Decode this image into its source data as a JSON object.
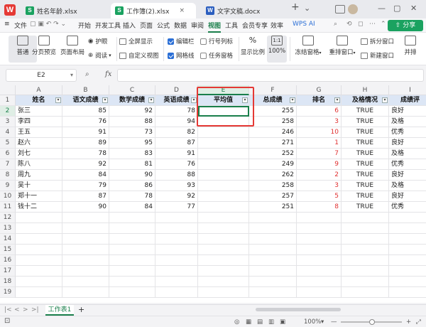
{
  "titlebar": {
    "logo": "W",
    "tabs": [
      {
        "label": "姓名年龄.xlsx",
        "icon": "S",
        "kind": "sheet"
      },
      {
        "label": "工作簿(2).xlsx",
        "icon": "S",
        "kind": "sheet"
      },
      {
        "label": "文字文稿.docx",
        "icon": "W",
        "kind": "doc"
      }
    ],
    "new_tab": "+",
    "dropdown": "⌄"
  },
  "menubar": {
    "file": "文件",
    "items": [
      "开始",
      "开发工具",
      "插入",
      "页面",
      "公式",
      "数据",
      "审阅",
      "视图",
      "工具",
      "会员专享",
      "效率"
    ],
    "active": "视图",
    "wps_ai": "WPS AI",
    "share": "分享"
  },
  "ribbon": {
    "big_buttons": [
      "普通",
      "分页预览",
      "页面布局"
    ],
    "small_left": [
      "护眼",
      "阅读"
    ],
    "fullscreen": "全屏显示",
    "custom_view": "自定义视图",
    "checks": [
      {
        "label": "编辑栏",
        "checked": true
      },
      {
        "label": "网格线",
        "checked": true
      },
      {
        "label": "行号列标",
        "checked": false
      },
      {
        "label": "任务窗格",
        "checked": false
      }
    ],
    "display_ratio": "显示比例",
    "zoom_button": "100%",
    "freeze": "冻结窗格",
    "rearrange": "重排窗口",
    "split": "拆分窗口",
    "new_window": "新建窗口",
    "side_by_side": "并排"
  },
  "formula": {
    "cell_ref": "E2",
    "fx": "fx",
    "value": ""
  },
  "columns": [
    "A",
    "B",
    "C",
    "D",
    "E",
    "F",
    "G",
    "H",
    "I"
  ],
  "rows": [
    "1",
    "2",
    "3",
    "4",
    "5",
    "6",
    "7",
    "8",
    "9",
    "10",
    "11",
    "12",
    "13",
    "14",
    "15",
    "16",
    "17",
    "18",
    "19"
  ],
  "table": {
    "headers": [
      "姓名",
      "语文成绩",
      "数学成绩",
      "英语成绩",
      "平均值",
      "总成绩",
      "排名",
      "及格情况",
      "成绩评"
    ],
    "data": [
      [
        "张三",
        "85",
        "92",
        "78",
        "",
        "255",
        "6",
        "TRUE",
        "良好"
      ],
      [
        "李四",
        "76",
        "88",
        "94",
        "",
        "258",
        "3",
        "TRUE",
        "及格"
      ],
      [
        "王五",
        "91",
        "73",
        "82",
        "",
        "246",
        "10",
        "TRUE",
        "优秀"
      ],
      [
        "赵六",
        "89",
        "95",
        "87",
        "",
        "271",
        "1",
        "TRUE",
        "良好"
      ],
      [
        "刘七",
        "78",
        "83",
        "91",
        "",
        "252",
        "7",
        "TRUE",
        "及格"
      ],
      [
        "陈八",
        "92",
        "81",
        "76",
        "",
        "249",
        "9",
        "TRUE",
        "优秀"
      ],
      [
        "周九",
        "84",
        "90",
        "88",
        "",
        "262",
        "2",
        "TRUE",
        "良好"
      ],
      [
        "吴十",
        "79",
        "86",
        "93",
        "",
        "258",
        "3",
        "TRUE",
        "及格"
      ],
      [
        "郑十一",
        "87",
        "78",
        "92",
        "",
        "257",
        "5",
        "TRUE",
        "良好"
      ],
      [
        "钱十二",
        "90",
        "84",
        "77",
        "",
        "251",
        "8",
        "TRUE",
        "优秀"
      ]
    ]
  },
  "sheets": {
    "nav": [
      "|<",
      "<",
      ">",
      ">|"
    ],
    "active": "工作表1",
    "add": "+"
  },
  "status": {
    "zoom": "100%",
    "zoom_minus": "—",
    "zoom_plus": "+",
    "zoom_arrow": "▾"
  },
  "colors": {
    "accent": "#1a7f4b",
    "header_fill": "#dce6f5",
    "rank_red": "#e03030",
    "highlight_box": "#e53935"
  }
}
